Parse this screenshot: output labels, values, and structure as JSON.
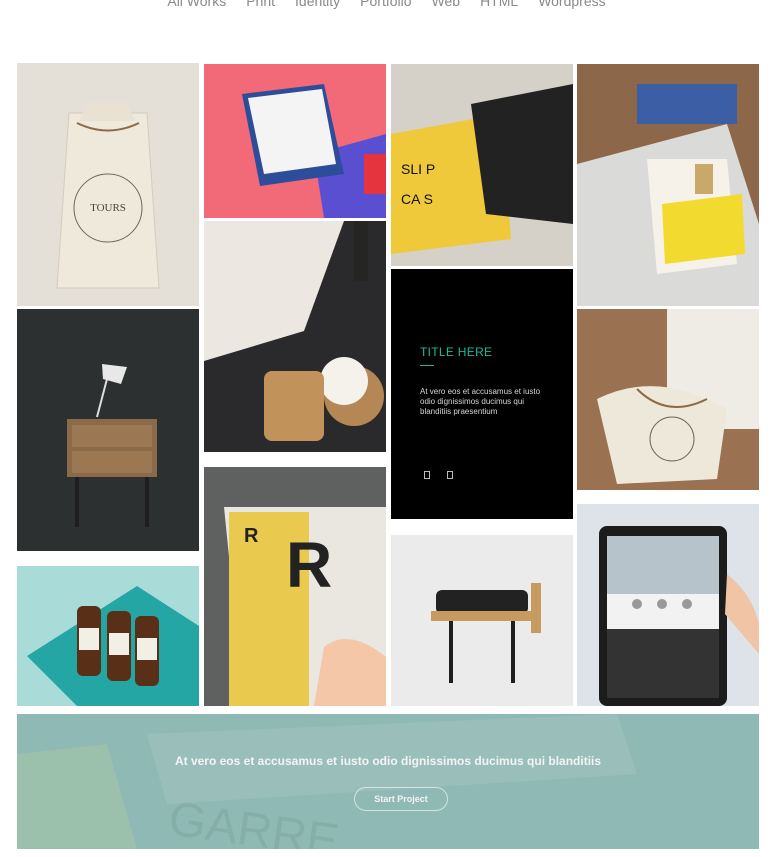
{
  "filter_nav": {
    "items": [
      "All Works",
      "Print",
      "Identity",
      "Portfolio",
      "Web",
      "HTML",
      "Wordpress"
    ]
  },
  "portfolio": {
    "caption": {
      "title": "TITLE HERE",
      "text": "At vero eos et accusamus et iusto odio dignissimos ducimus qui blanditiis praesentium"
    }
  },
  "cta": {
    "text": "At vero eos et accusamus et iusto odio dignissimos ducimus qui blanditiis",
    "button_label": "Start Project"
  },
  "colors": {
    "accent": "#1fb89a",
    "cta_overlay": "#8fb9b4"
  }
}
